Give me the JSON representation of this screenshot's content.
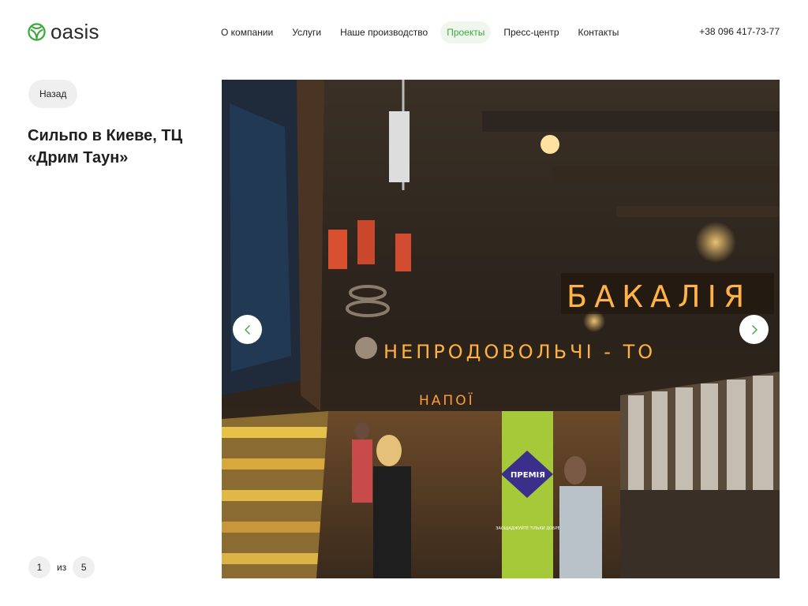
{
  "brand": {
    "name": "oasis",
    "accent": "#3daa3d"
  },
  "nav": {
    "items": [
      {
        "label": "О компании"
      },
      {
        "label": "Услуги"
      },
      {
        "label": "Наше производство"
      },
      {
        "label": "Проекты",
        "active": true
      },
      {
        "label": "Пресс-центр"
      },
      {
        "label": "Контакты"
      }
    ]
  },
  "contact": {
    "phone": "+38 096 417-73-77"
  },
  "page": {
    "back_label": "Назад",
    "title": "Сильпо в Киеве, ТЦ «Дрим Таун»"
  },
  "slider": {
    "current": "1",
    "separator": "из",
    "total": "5",
    "prev_icon": "chevron-left-icon",
    "next_icon": "chevron-right-icon"
  },
  "photo_text": {
    "sign_main": "БАКАЛІЯ",
    "sign_secondary": "НЕПРОДОВОЛЬЧІ - ТО",
    "sign_small": "НАПОЇ",
    "banner": "ПРЕМІЯ",
    "banner_sub": "ЗАОЩАДЖУЙТЕ ТІЛЬКИ ДОБРЕ"
  }
}
